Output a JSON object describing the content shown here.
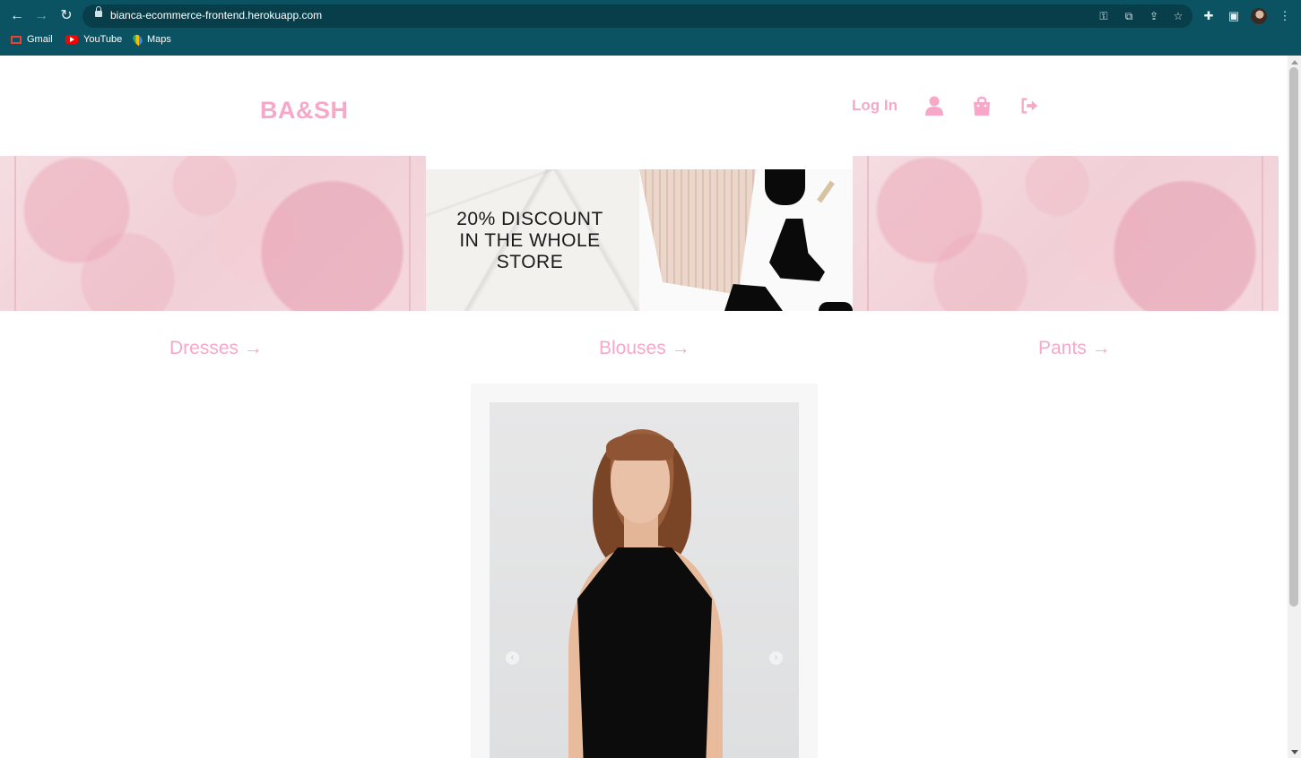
{
  "browser": {
    "url": "bianca-ecommerce-frontend.herokuapp.com",
    "bookmarks": [
      {
        "label": "Gmail",
        "icon": "gmail-icon"
      },
      {
        "label": "YouTube",
        "icon": "youtube-icon"
      },
      {
        "label": "Maps",
        "icon": "maps-icon"
      }
    ]
  },
  "header": {
    "logo": "BA&SH",
    "login_label": "Log In",
    "icons": [
      "user-icon",
      "shopping-bag-icon",
      "logout-icon"
    ]
  },
  "banner": {
    "promo_line1": "20% DISCOUNT",
    "promo_line2": "IN THE WHOLE",
    "promo_line3": "STORE"
  },
  "categories": [
    {
      "label": "Dresses",
      "arrow": "→"
    },
    {
      "label": "Blouses",
      "arrow": "→"
    },
    {
      "label": "Pants",
      "arrow": "→"
    }
  ],
  "carousel": {
    "prev": "‹",
    "next": "›"
  },
  "colors": {
    "accent": "#f7a8c9",
    "chrome": "#0b5262"
  }
}
